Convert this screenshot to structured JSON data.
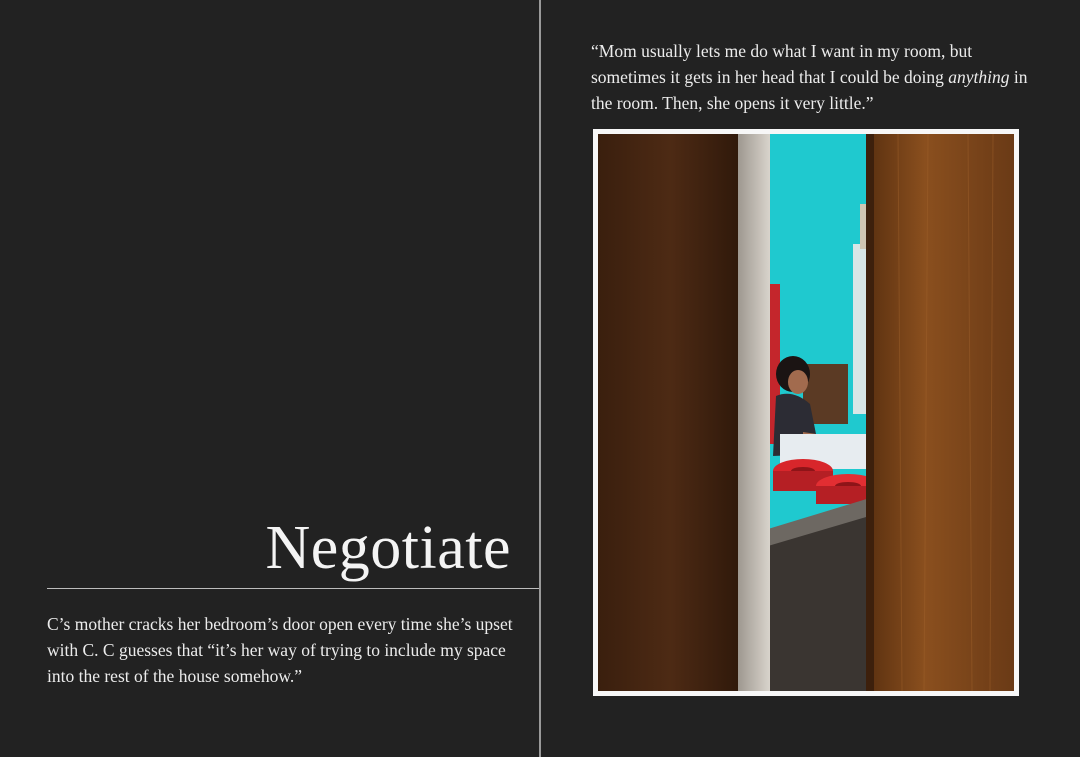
{
  "left_page": {
    "title": "Negotiate",
    "caption": "C’s mother cracks her bedroom’s door open every time she’s upset with C. C guesses that “it’s her way of trying to include my space into the rest of the house somehow.”"
  },
  "right_page": {
    "quote_part1": "“Mom usually lets me do what I want in my room, but sometimes it gets in her head that I could be doing ",
    "quote_emphasis": "anything",
    "quote_part2": " in the room. Then, she opens it very little.”"
  },
  "colors": {
    "background": "#222222",
    "text": "#ececec",
    "spine": "#9a9a9a",
    "photo_border": "#f7f7f7",
    "wall_teal": "#1fc9cf",
    "door_wood": "#6b3c1a",
    "cushion_red": "#d8262b"
  }
}
